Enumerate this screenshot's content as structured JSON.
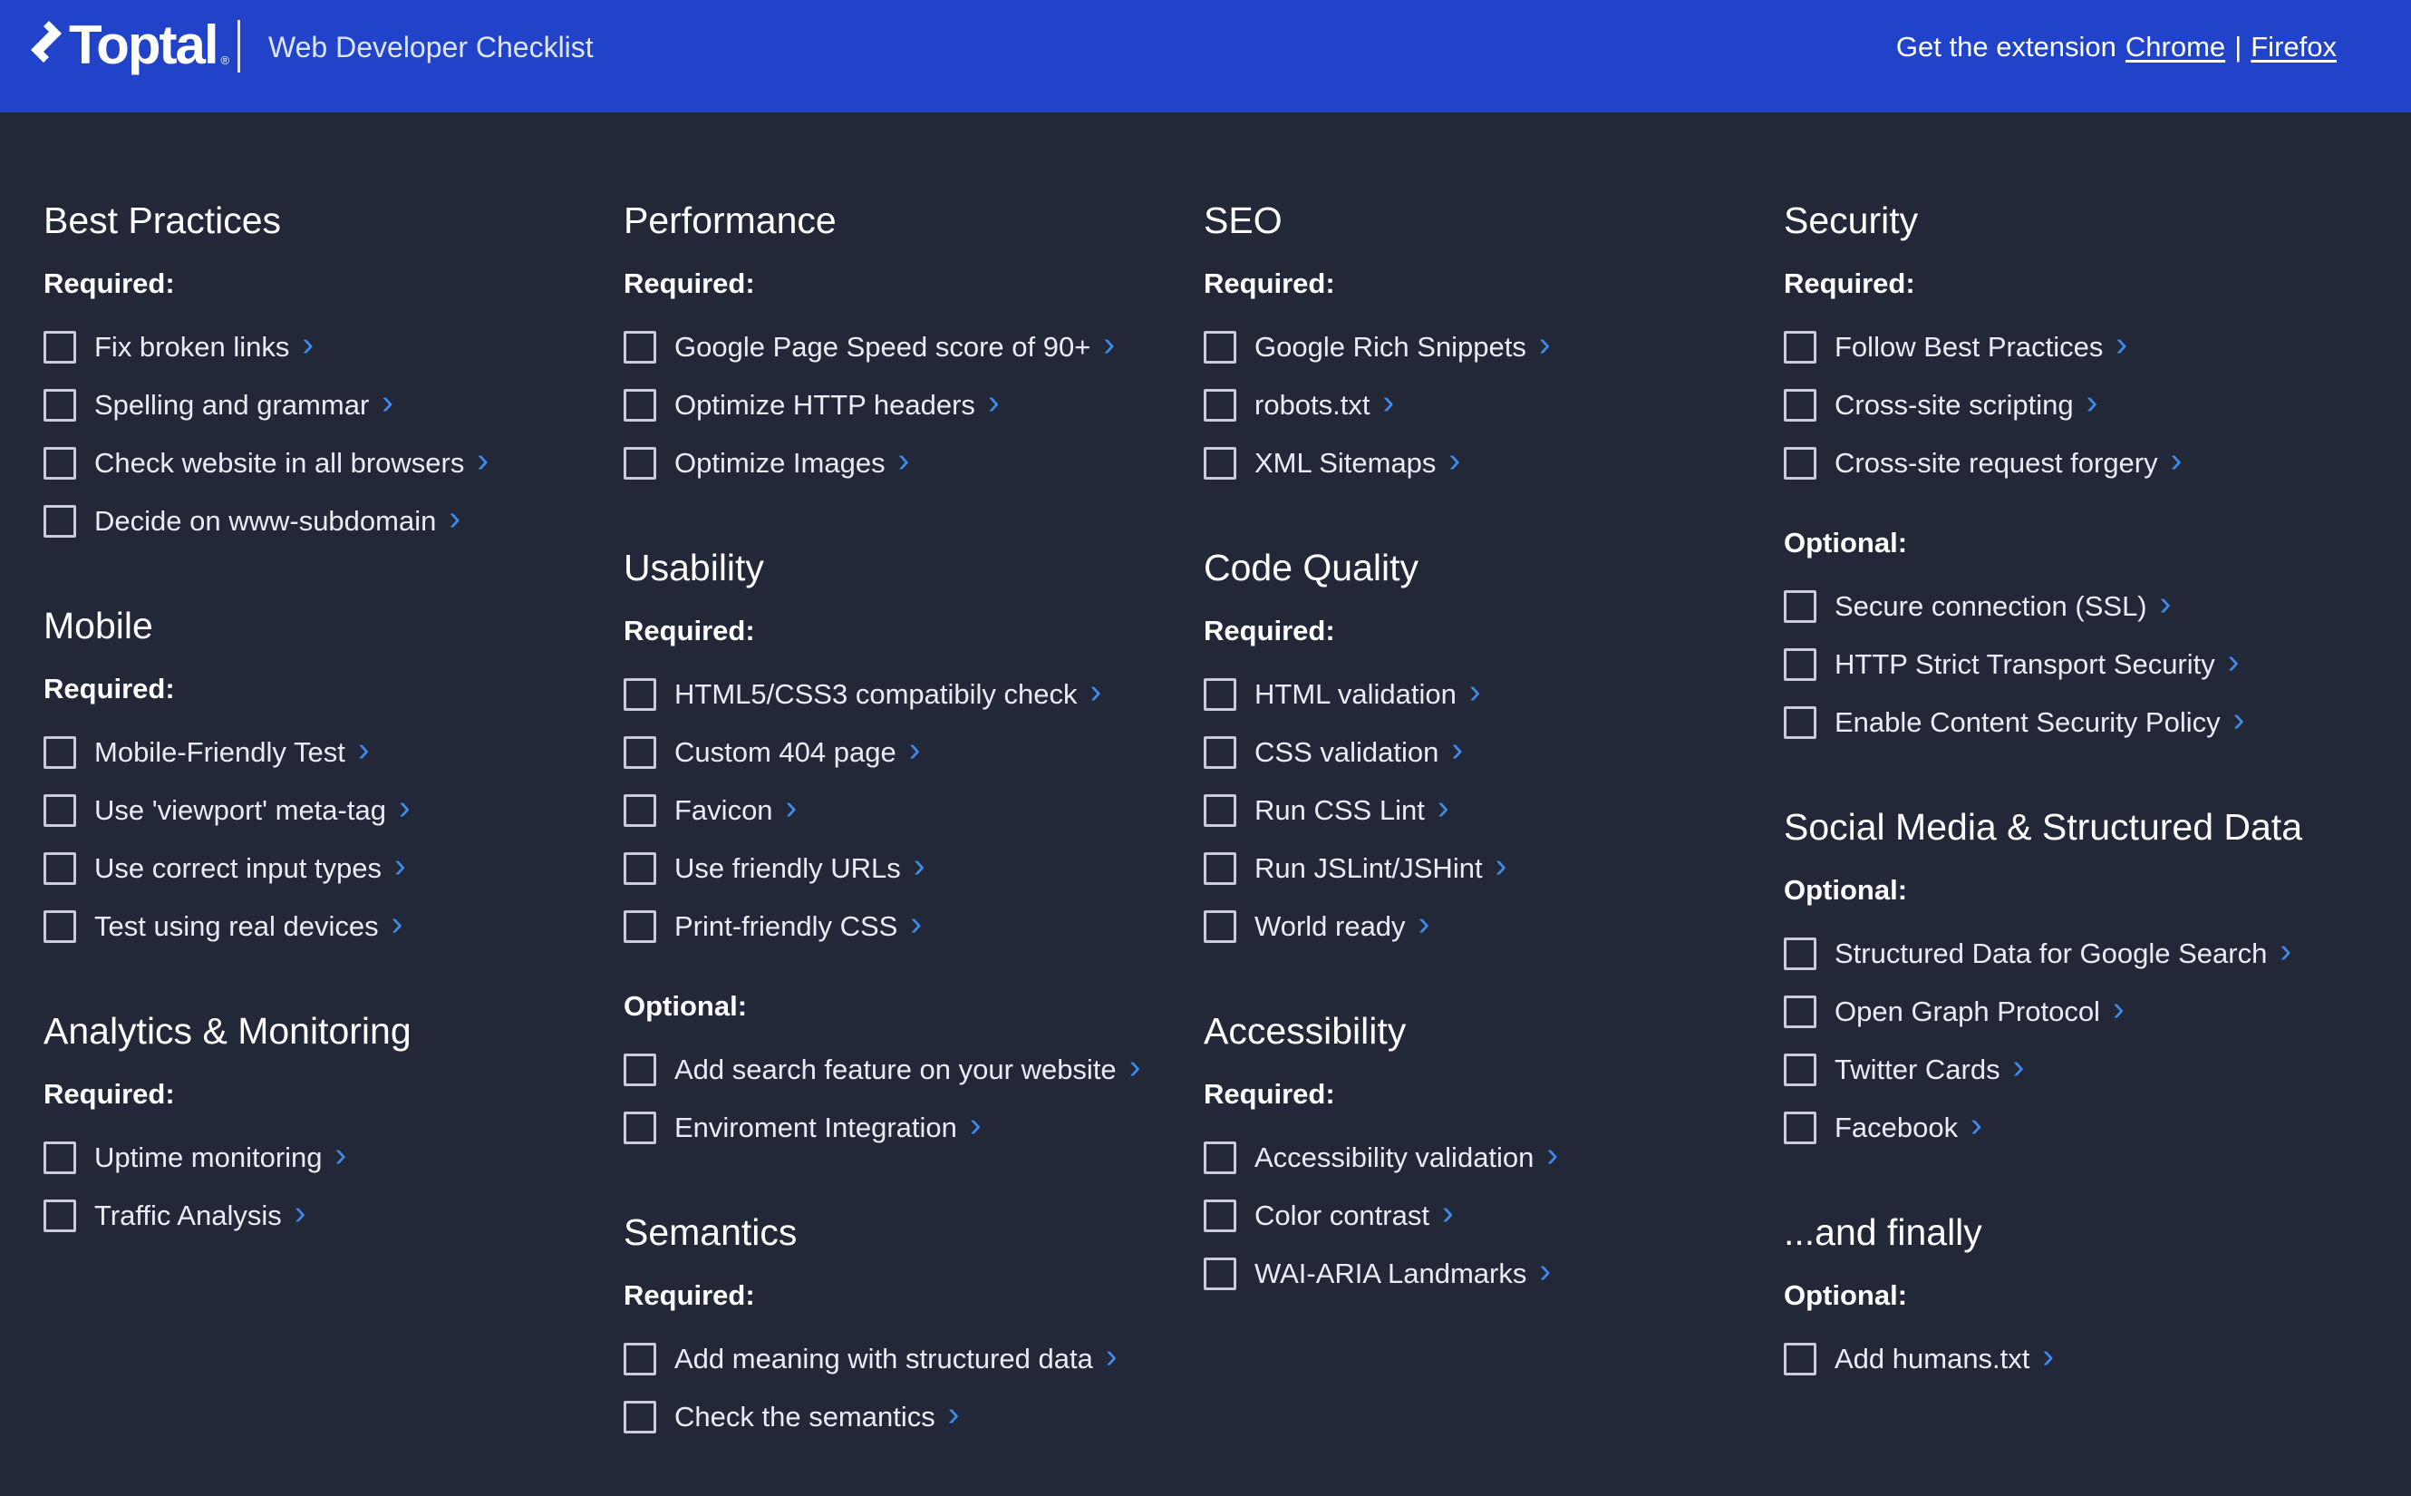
{
  "header": {
    "brand": "Toptal",
    "brand_mark": "®",
    "title": "Web Developer Checklist",
    "extension_prefix": "Get the extension",
    "chrome_link": "Chrome",
    "separator": "|",
    "firefox_link": "Firefox"
  },
  "colors": {
    "header_bg": "#2043c9",
    "page_bg": "#232838",
    "chevron": "#3d8cf0"
  },
  "columns": [
    {
      "sections": [
        {
          "title": "Best Practices",
          "groups": [
            {
              "label": "Required:",
              "items": [
                "Fix broken links",
                "Spelling and grammar",
                "Check website in all browsers",
                "Decide on www-subdomain"
              ]
            }
          ]
        },
        {
          "title": "Mobile",
          "groups": [
            {
              "label": "Required:",
              "items": [
                "Mobile-Friendly Test",
                "Use 'viewport' meta-tag",
                "Use correct input types",
                "Test using real devices"
              ]
            }
          ]
        },
        {
          "title": "Analytics & Monitoring",
          "groups": [
            {
              "label": "Required:",
              "items": [
                "Uptime monitoring",
                "Traffic Analysis"
              ]
            }
          ]
        }
      ]
    },
    {
      "sections": [
        {
          "title": "Performance",
          "groups": [
            {
              "label": "Required:",
              "items": [
                "Google Page Speed score of 90+",
                "Optimize HTTP headers",
                "Optimize Images"
              ]
            }
          ]
        },
        {
          "title": "Usability",
          "groups": [
            {
              "label": "Required:",
              "items": [
                "HTML5/CSS3 compatibily check",
                "Custom 404 page",
                "Favicon",
                "Use friendly URLs",
                "Print-friendly CSS"
              ]
            },
            {
              "label": "Optional:",
              "items": [
                "Add search feature on your website",
                "Enviroment Integration"
              ]
            }
          ]
        },
        {
          "title": "Semantics",
          "groups": [
            {
              "label": "Required:",
              "items": [
                "Add meaning with structured data",
                "Check the semantics"
              ]
            }
          ]
        }
      ]
    },
    {
      "sections": [
        {
          "title": "SEO",
          "groups": [
            {
              "label": "Required:",
              "items": [
                "Google Rich Snippets",
                "robots.txt",
                "XML Sitemaps"
              ]
            }
          ]
        },
        {
          "title": "Code Quality",
          "groups": [
            {
              "label": "Required:",
              "items": [
                "HTML validation",
                "CSS validation",
                "Run CSS Lint",
                "Run JSLint/JSHint",
                "World ready"
              ]
            }
          ]
        },
        {
          "title": "Accessibility",
          "groups": [
            {
              "label": "Required:",
              "items": [
                "Accessibility validation",
                "Color contrast",
                "WAI-ARIA Landmarks"
              ]
            }
          ]
        }
      ]
    },
    {
      "sections": [
        {
          "title": "Security",
          "groups": [
            {
              "label": "Required:",
              "items": [
                "Follow Best Practices",
                "Cross-site scripting",
                "Cross-site request forgery"
              ]
            },
            {
              "label": "Optional:",
              "items": [
                "Secure connection (SSL)",
                "HTTP Strict Transport Security",
                "Enable Content Security Policy"
              ]
            }
          ]
        },
        {
          "title": "Social Media & Structured Data",
          "groups": [
            {
              "label": "Optional:",
              "items": [
                "Structured Data for Google Search",
                "Open Graph Protocol",
                "Twitter Cards",
                "Facebook"
              ]
            }
          ]
        },
        {
          "title": "...and finally",
          "groups": [
            {
              "label": "Optional:",
              "items": [
                "Add humans.txt"
              ]
            }
          ]
        }
      ]
    }
  ],
  "icons": {
    "item_link": "chevron-right-icon",
    "item_check": "checkbox-icon",
    "logo": "toptal-logo-icon"
  }
}
